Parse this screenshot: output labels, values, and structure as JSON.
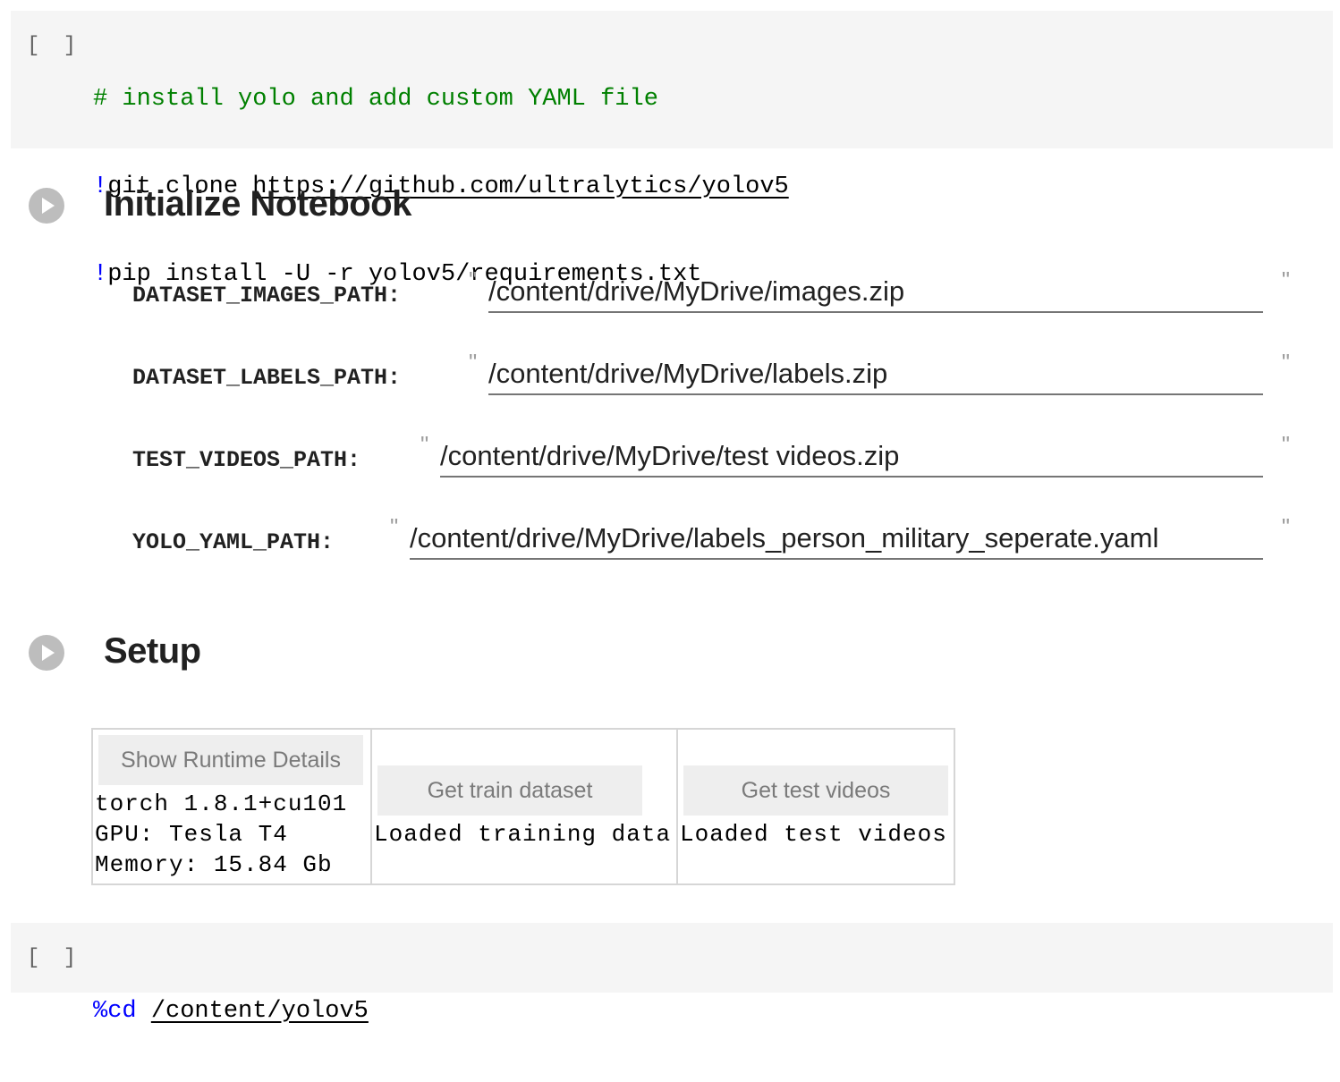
{
  "cell1": {
    "bracket": "[ ]",
    "comment": "# install yolo and add custom YAML file",
    "line2_bang": "!",
    "line2_cmd": "git clone ",
    "line2_link": "https://github.com/ultralytics/yolov5",
    "line3_bang": "!",
    "line3_cmd": "pip install -U -r yolov5/requirements.txt"
  },
  "section_init": {
    "title": "Initialize Notebook",
    "fields": [
      {
        "label": "DATASET_IMAGES_PATH:",
        "value": "/content/drive/MyDrive/images.zip"
      },
      {
        "label": "DATASET_LABELS_PATH:",
        "value": "/content/drive/MyDrive/labels.zip"
      },
      {
        "label": "TEST_VIDEOS_PATH:",
        "value": "/content/drive/MyDrive/test videos.zip"
      },
      {
        "label": "YOLO_YAML_PATH:",
        "value": "/content/drive/MyDrive/labels_person_military_seperate.yaml"
      }
    ],
    "quote": "\""
  },
  "section_setup": {
    "title": "Setup",
    "widgets": [
      {
        "button": "Show Runtime Details",
        "output": "torch 1.8.1+cu101\nGPU: Tesla T4\nMemory: 15.84 Gb"
      },
      {
        "button": "Get train dataset",
        "output": "Loaded training data"
      },
      {
        "button": "Get test videos",
        "output": "Loaded test videos"
      }
    ]
  },
  "cell2": {
    "bracket": "[ ]",
    "magic": "%cd",
    "path": "/content/yolov5"
  }
}
